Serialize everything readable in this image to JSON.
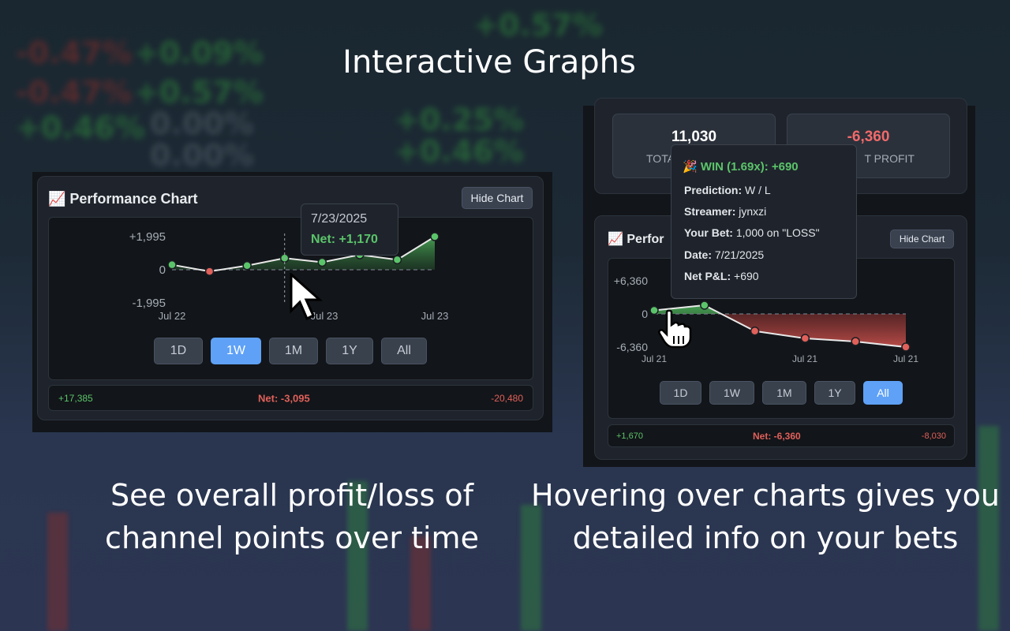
{
  "headline": "Interactive Graphs",
  "captions": {
    "left_line1": "See overall profit/loss of",
    "left_line2": "channel points over time",
    "right_line1": "Hovering over charts gives you",
    "right_line2": "detailed info on your bets"
  },
  "left_panel": {
    "title": "📈 Performance Chart",
    "hide_label": "Hide Chart",
    "y_labels": [
      "+1,995",
      "0",
      "-1,995"
    ],
    "x_labels": [
      "Jul 22",
      "Jul 23",
      "Jul 23"
    ],
    "tooltip": {
      "date": "7/23/2025",
      "net": "Net: +1,170"
    },
    "ranges": [
      "1D",
      "1W",
      "1M",
      "1Y",
      "All"
    ],
    "active_range": "1W",
    "summary": {
      "gain": "+17,385",
      "net": "Net: -3,095",
      "loss": "-20,480"
    }
  },
  "right_panel": {
    "stats": [
      {
        "value": "11,030",
        "label": "TOTA",
        "color": "#ffffff"
      },
      {
        "value": "-6,360",
        "label": "T PROFIT",
        "color": "#f06a6a"
      }
    ],
    "title": "📈 Perfor",
    "hide_label": "Hide Chart",
    "y_labels": [
      "+6,360",
      "0",
      "-6,360"
    ],
    "x_labels": [
      "Jul 21",
      "Jul 21",
      "Jul 21"
    ],
    "tooltip": {
      "header": "🎉 WIN (1.69x): +690",
      "prediction_label": "Prediction:",
      "prediction": "W / L",
      "streamer_label": "Streamer:",
      "streamer": "jynxzi",
      "bet_label": "Your Bet:",
      "bet": "1,000 on \"LOSS\"",
      "date_label": "Date:",
      "date": "7/21/2025",
      "pnl_label": "Net P&L:",
      "pnl": "+690"
    },
    "ranges": [
      "1D",
      "1W",
      "1M",
      "1Y",
      "All"
    ],
    "active_range": "All",
    "summary": {
      "gain": "+1,670",
      "net": "Net: -6,360",
      "loss": "-8,030"
    }
  },
  "colors": {
    "green": "#5bc46a",
    "red": "#e0605a",
    "accent": "#5ea1f7"
  },
  "chart_data": [
    {
      "type": "line",
      "x": [
        "Jul 22",
        "",
        "",
        "",
        "",
        "",
        "",
        "Jul 23"
      ],
      "values": [
        300,
        -100,
        250,
        700,
        450,
        900,
        600,
        1995
      ],
      "ylim": [
        -1995,
        1995
      ]
    },
    {
      "type": "line",
      "x": [
        "Jul 21",
        "Jul 21",
        "Jul 21",
        "Jul 21",
        "Jul 21",
        "Jul 21"
      ],
      "values": [
        690,
        1670,
        -3300,
        -4700,
        -5300,
        -6360
      ],
      "ylim": [
        -6360,
        6360
      ]
    }
  ]
}
